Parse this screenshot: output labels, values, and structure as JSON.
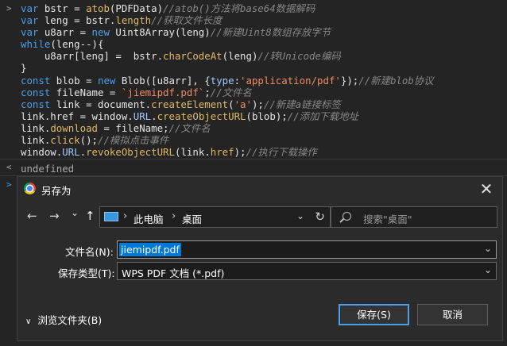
{
  "console": {
    "code_lines": [
      [
        {
          "t": "var ",
          "c": "kw"
        },
        {
          "t": "bstr = "
        },
        {
          "t": "atob",
          "c": "fn"
        },
        {
          "t": "(PDFData)"
        },
        {
          "t": "//atob()方法将base64数据解码",
          "c": "cm"
        }
      ],
      [
        {
          "t": "var ",
          "c": "kw"
        },
        {
          "t": "leng = bstr."
        },
        {
          "t": "length",
          "c": "fn"
        },
        {
          "t": "//获取文件长度",
          "c": "cm"
        }
      ],
      [
        {
          "t": "var ",
          "c": "kw"
        },
        {
          "t": "u8arr = "
        },
        {
          "t": "new ",
          "c": "kw"
        },
        {
          "t": "Uint8Array(leng)"
        },
        {
          "t": "//新建Uint8数组存放字节",
          "c": "cm"
        }
      ],
      [
        {
          "t": "while",
          "c": "kw"
        },
        {
          "t": "(leng--){"
        }
      ],
      [
        {
          "t": "    u8arr[leng] =  bstr."
        },
        {
          "t": "charCodeAt",
          "c": "fn"
        },
        {
          "t": "(leng)"
        },
        {
          "t": "//转Unicode编码",
          "c": "cm"
        }
      ],
      [
        {
          "t": "}"
        }
      ],
      [
        {
          "t": "const ",
          "c": "kw"
        },
        {
          "t": "blob = "
        },
        {
          "t": "new ",
          "c": "kw"
        },
        {
          "t": "Blob([u8arr], {"
        },
        {
          "t": "type",
          "c": "prop"
        },
        {
          "t": ":"
        },
        {
          "t": "'application/pdf'",
          "c": "str"
        },
        {
          "t": "});"
        },
        {
          "t": "//新建blob协议",
          "c": "cm"
        }
      ],
      [
        {
          "t": "const ",
          "c": "kw"
        },
        {
          "t": "fileName = "
        },
        {
          "t": "`jiemipdf.pdf`",
          "c": "str"
        },
        {
          "t": ";"
        },
        {
          "t": "//文件名",
          "c": "cm"
        }
      ],
      [
        {
          "t": "const ",
          "c": "kw"
        },
        {
          "t": "link = document."
        },
        {
          "t": "createElement",
          "c": "fn"
        },
        {
          "t": "("
        },
        {
          "t": "'a'",
          "c": "str"
        },
        {
          "t": ");"
        },
        {
          "t": "//新建a链接标签",
          "c": "cm"
        }
      ],
      [
        {
          "t": "link.href = window."
        },
        {
          "t": "URL",
          "c": "prop"
        },
        {
          "t": "."
        },
        {
          "t": "createObjectURL",
          "c": "fn"
        },
        {
          "t": "(blob);"
        },
        {
          "t": "//添加下载地址",
          "c": "cm"
        }
      ],
      [
        {
          "t": "link."
        },
        {
          "t": "download",
          "c": "fn"
        },
        {
          "t": " = fileName;"
        },
        {
          "t": "//文件名",
          "c": "cm"
        }
      ],
      [
        {
          "t": "link."
        },
        {
          "t": "click",
          "c": "fn"
        },
        {
          "t": "();"
        },
        {
          "t": "//模拟点击事件",
          "c": "cm"
        }
      ],
      [
        {
          "t": "window."
        },
        {
          "t": "URL",
          "c": "prop"
        },
        {
          "t": "."
        },
        {
          "t": "revokeObjectURL",
          "c": "fn"
        },
        {
          "t": "(link."
        },
        {
          "t": "href",
          "c": "fn"
        },
        {
          "t": ");"
        },
        {
          "t": "//执行下载操作",
          "c": "cm"
        }
      ]
    ],
    "result": "undefined"
  },
  "dialog": {
    "title": "另存为",
    "close_glyph": "✕",
    "nav": {
      "back": "←",
      "forward": "→",
      "recent": "⌄",
      "up": "↑"
    },
    "breadcrumbs": [
      "此电脑",
      "桌面"
    ],
    "search_placeholder": "搜索\"桌面\"",
    "filename_label": "文件名(N):",
    "filename_value": "jiemipdf.pdf",
    "filetype_label": "保存类型(T):",
    "filetype_value": "WPS PDF 文档 (*.pdf)",
    "browse_folders": "浏览文件夹(B)",
    "save_button": "保存(S)",
    "cancel_button": "取消"
  },
  "colors": {
    "keyword": "#4a9fe8",
    "function": "#e0b964",
    "string": "#ef8b60",
    "comment": "#878787",
    "accent": "#0078d7"
  }
}
